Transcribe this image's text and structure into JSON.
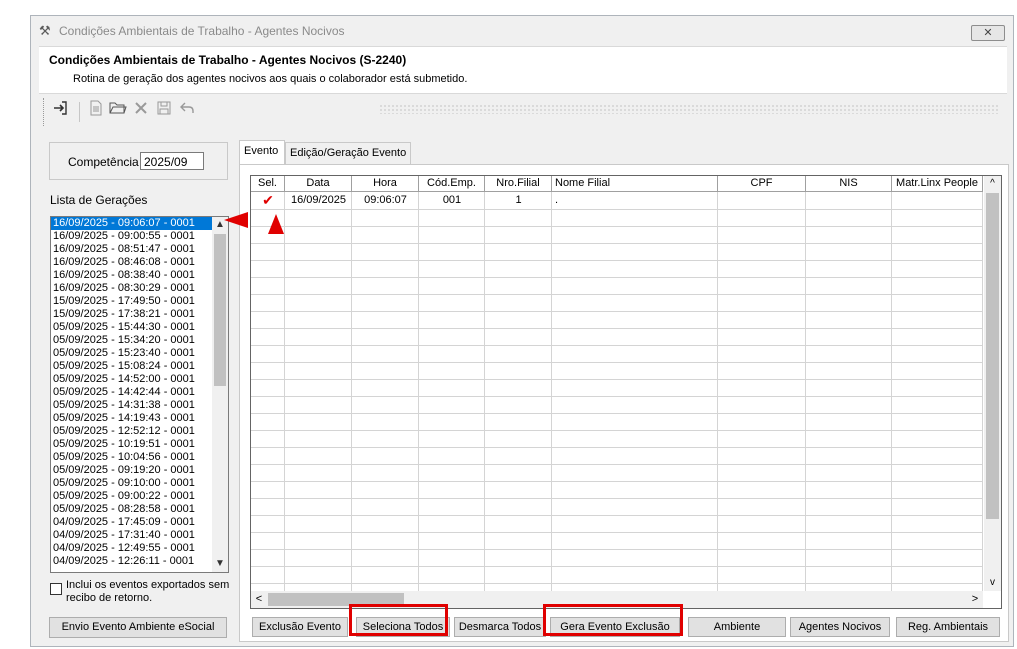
{
  "window": {
    "title": "Condições Ambientais de Trabalho - Agentes Nocivos",
    "close_symbol": "✕"
  },
  "header": {
    "title": "Condições Ambientais de Trabalho - Agentes Nocivos (S-2240)",
    "subtitle": "Rotina de geração dos agentes nocivos aos quais o colaborador está submetido."
  },
  "toolbar": {
    "icons": [
      "exit-icon",
      "new-document-icon",
      "open-folder-icon",
      "delete-icon",
      "save-icon",
      "undo-icon"
    ]
  },
  "competencia": {
    "label": "Competência",
    "value": "2025/09"
  },
  "lista": {
    "label": "Lista de Gerações",
    "items": [
      "16/09/2025 - 09:06:07 - 0001",
      "16/09/2025 - 09:00:55 - 0001",
      "16/09/2025 - 08:51:47 - 0001",
      "16/09/2025 - 08:46:08 - 0001",
      "16/09/2025 - 08:38:40 - 0001",
      "16/09/2025 - 08:30:29 - 0001",
      "15/09/2025 - 17:49:50 - 0001",
      "15/09/2025 - 17:38:21 - 0001",
      "05/09/2025 - 15:44:30 - 0001",
      "05/09/2025 - 15:34:20 - 0001",
      "05/09/2025 - 15:23:40 - 0001",
      "05/09/2025 - 15:08:24 - 0001",
      "05/09/2025 - 14:52:00 - 0001",
      "05/09/2025 - 14:42:44 - 0001",
      "05/09/2025 - 14:31:38 - 0001",
      "05/09/2025 - 14:19:43 - 0001",
      "05/09/2025 - 12:52:12 - 0001",
      "05/09/2025 - 10:19:51 - 0001",
      "05/09/2025 - 10:04:56 - 0001",
      "05/09/2025 - 09:19:20 - 0001",
      "05/09/2025 - 09:10:00 - 0001",
      "05/09/2025 - 09:00:22 - 0001",
      "05/09/2025 - 08:28:58 - 0001",
      "04/09/2025 - 17:45:09 - 0001",
      "04/09/2025 - 17:31:40 - 0001",
      "04/09/2025 - 12:49:55 - 0001",
      "04/09/2025 - 12:26:11 - 0001"
    ]
  },
  "checkbox": {
    "label": "Inclui os eventos exportados sem recibo de retorno.",
    "checked": false
  },
  "buttons": {
    "envio": "Envio Evento Ambiente eSocial",
    "exclusao": "Exclusão Evento",
    "seleciona": "Seleciona Todos",
    "desmarca": "Desmarca Todos",
    "gera": "Gera Evento Exclusão",
    "ambiente": "Ambiente",
    "agentes": "Agentes Nocivos",
    "reg": "Reg. Ambientais"
  },
  "tabs": [
    {
      "label": "Evento",
      "active": true
    },
    {
      "label": "Edição/Geração Evento",
      "active": false
    }
  ],
  "grid": {
    "columns": [
      "Sel.",
      "Data",
      "Hora",
      "Cód.Emp.",
      "Nro.Filial",
      "Nome Filial",
      "CPF",
      "NIS",
      "Matr.Linx People"
    ],
    "rows": [
      {
        "sel": "✔",
        "data": "16/09/2025",
        "hora": "09:06:07",
        "cod_emp": "001",
        "nro_filial": "1",
        "nome_filial": ".",
        "cpf": "",
        "nis": "",
        "matr": ""
      }
    ]
  },
  "annotation_color": "#e00000"
}
